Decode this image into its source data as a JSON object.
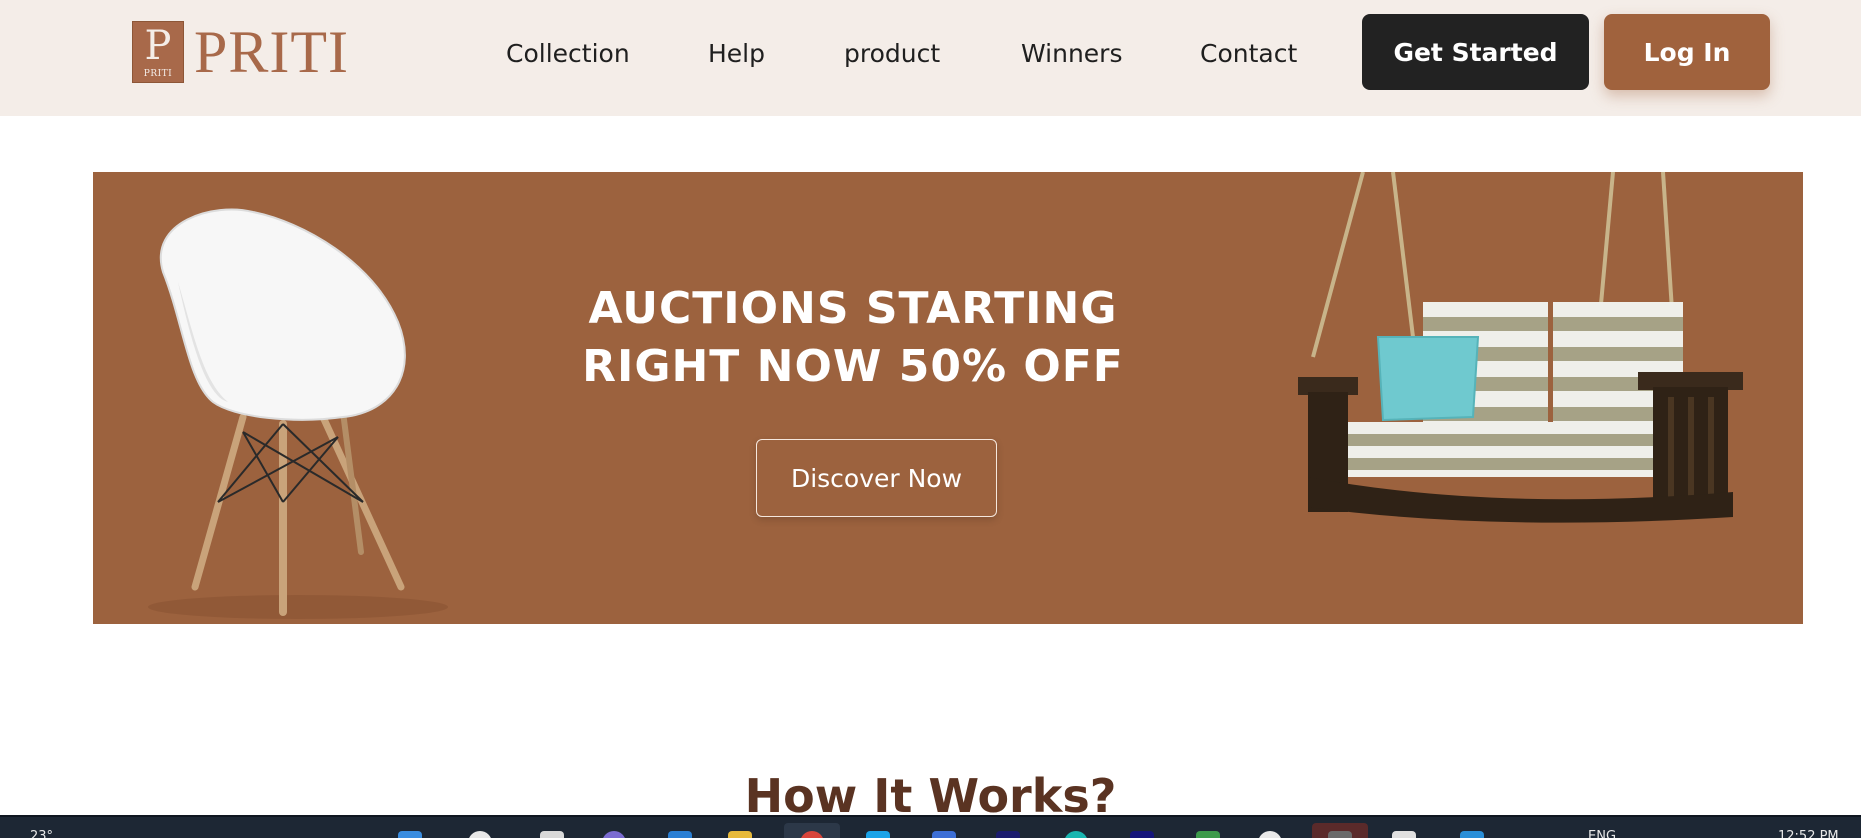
{
  "header": {
    "logo_text": "PRITI",
    "logo_badge_letter": "P",
    "logo_badge_small": "PRITI",
    "nav": [
      {
        "label": "Collection"
      },
      {
        "label": "Help"
      },
      {
        "label": "product"
      },
      {
        "label": "Winners"
      },
      {
        "label": "Contact"
      }
    ],
    "get_started_label": "Get Started",
    "login_label": "Log In"
  },
  "banner": {
    "headline_line1": "AUCTIONS STARTING",
    "headline_line2": "RIGHT NOW 50% OFF",
    "cta_label": "Discover Now",
    "background_color": "#9c623e",
    "images": [
      "chair-image",
      "porch-swing-image"
    ]
  },
  "section": {
    "title": "How It Works?"
  },
  "taskbar": {
    "weather": "23°",
    "language": "ENG",
    "time": "12:52 PM"
  },
  "colors": {
    "accent": "#a0623d",
    "dark_button": "#222222",
    "header_bg": "#f4ede8",
    "heading_brown": "#5a3322"
  }
}
